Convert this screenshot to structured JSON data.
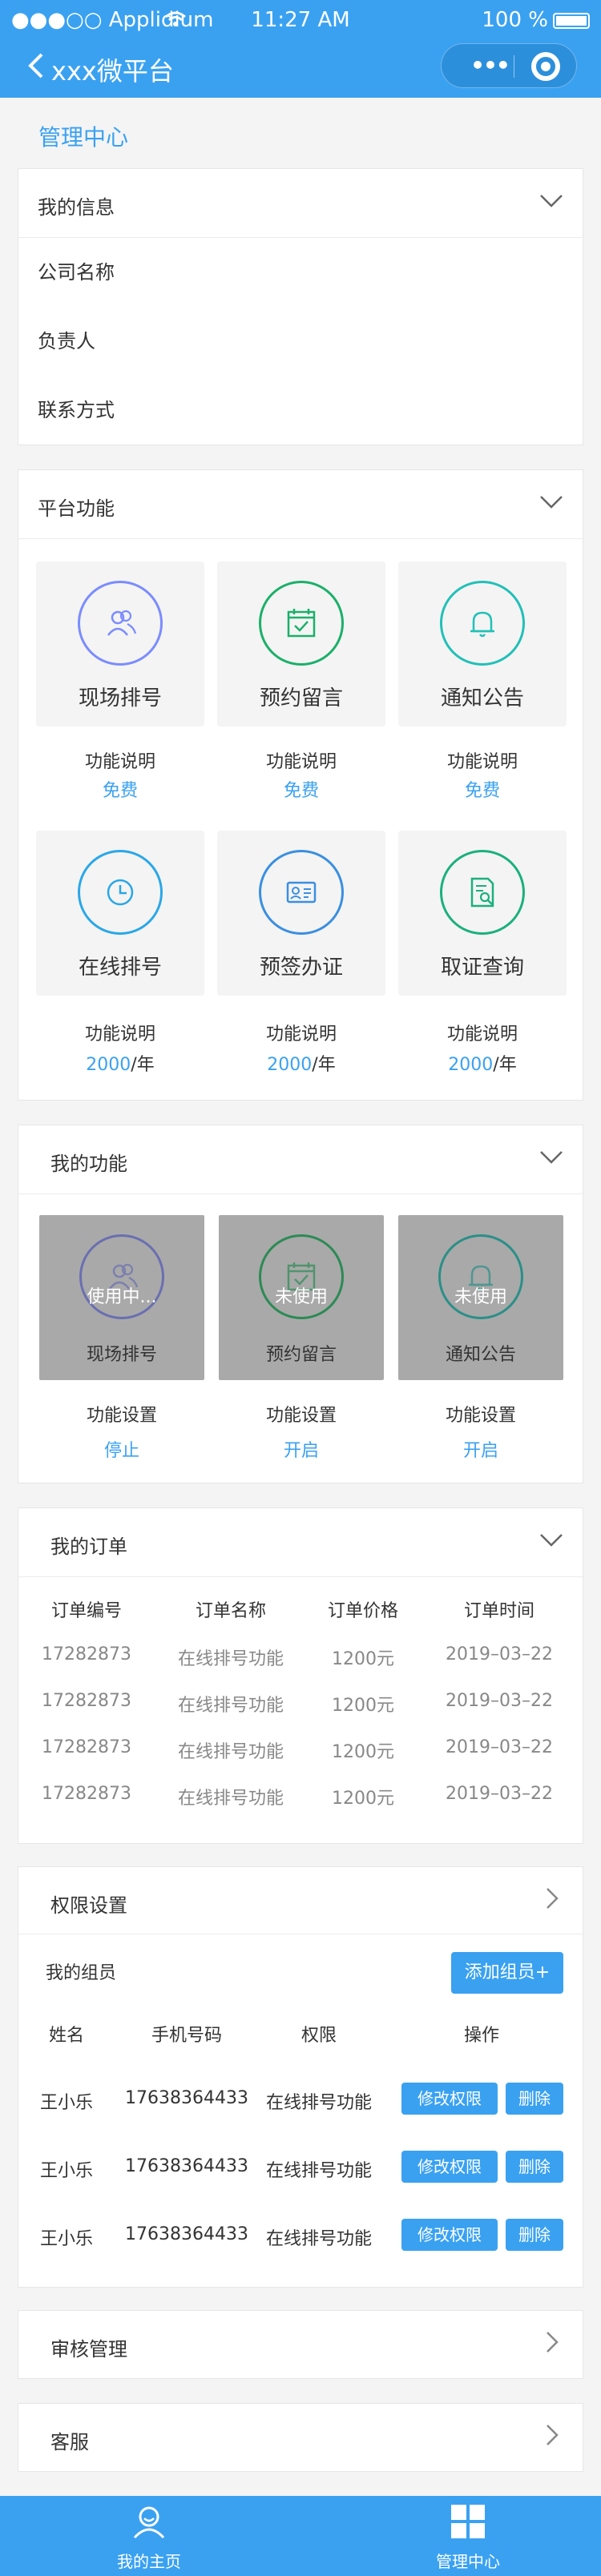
{
  "status": {
    "carrier": "●●●○○ Applidium",
    "time": "11:27 AM",
    "battery": "100 %"
  },
  "nav": {
    "title": "xxx微平台"
  },
  "page_title": "管理中心",
  "my_info": {
    "title": "我的信息",
    "rows": [
      "公司名称",
      "负责人",
      "联系方式"
    ]
  },
  "platform": {
    "title": "平台功能",
    "items": [
      {
        "name": "现场排号",
        "desc": "功能说明",
        "price": "免费",
        "unit": "",
        "color": "#7b8cff",
        "icon": "users-icon"
      },
      {
        "name": "预约留言",
        "desc": "功能说明",
        "price": "免费",
        "unit": "",
        "color": "#1bb06a",
        "icon": "calendar-check-icon"
      },
      {
        "name": "通知公告",
        "desc": "功能说明",
        "price": "免费",
        "unit": "",
        "color": "#22c0b8",
        "icon": "bell-icon"
      },
      {
        "name": "在线排号",
        "desc": "功能说明",
        "price": "2000",
        "unit": "/年",
        "color": "#2aa7e8",
        "icon": "clock-icon"
      },
      {
        "name": "预签办证",
        "desc": "功能说明",
        "price": "2000",
        "unit": "/年",
        "color": "#3a8fe0",
        "icon": "id-card-icon"
      },
      {
        "name": "取证查询",
        "desc": "功能说明",
        "price": "2000",
        "unit": "/年",
        "color": "#1bb07e",
        "icon": "doc-search-icon"
      }
    ]
  },
  "my_functions": {
    "title": "我的功能",
    "items": [
      {
        "name": "现场排号",
        "overlay": "使用中...",
        "label": "功能设置",
        "action": "停止",
        "icon": "users-icon"
      },
      {
        "name": "预约留言",
        "overlay": "未使用",
        "label": "功能设置",
        "action": "开启",
        "icon": "calendar-check-icon"
      },
      {
        "name": "通知公告",
        "overlay": "未使用",
        "label": "功能设置",
        "action": "开启",
        "icon": "bell-icon"
      }
    ]
  },
  "orders": {
    "title": "我的订单",
    "headers": [
      "订单编号",
      "订单名称",
      "订单价格",
      "订单时间"
    ],
    "rows": [
      [
        "17282873",
        "在线排号功能",
        "1200元",
        "2019–03–22"
      ],
      [
        "17282873",
        "在线排号功能",
        "1200元",
        "2019–03–22"
      ],
      [
        "17282873",
        "在线排号功能",
        "1200元",
        "2019–03–22"
      ],
      [
        "17282873",
        "在线排号功能",
        "1200元",
        "2019–03–22"
      ]
    ]
  },
  "permissions": {
    "title": "权限设置",
    "members_label": "我的组员",
    "add_button": "添加组员+",
    "headers": [
      "姓名",
      "手机号码",
      "权限",
      "操作"
    ],
    "rows": [
      {
        "name": "王小乐",
        "phone": "17638364433",
        "perm": "在线排号功能",
        "edit": "修改权限",
        "del": "删除"
      },
      {
        "name": "王小乐",
        "phone": "17638364433",
        "perm": "在线排号功能",
        "edit": "修改权限",
        "del": "删除"
      },
      {
        "name": "王小乐",
        "phone": "17638364433",
        "perm": "在线排号功能",
        "edit": "修改权限",
        "del": "删除"
      }
    ]
  },
  "review": {
    "title": "审核管理"
  },
  "service": {
    "title": "客服"
  },
  "tabbar": {
    "home": "我的主页",
    "admin": "管理中心"
  }
}
